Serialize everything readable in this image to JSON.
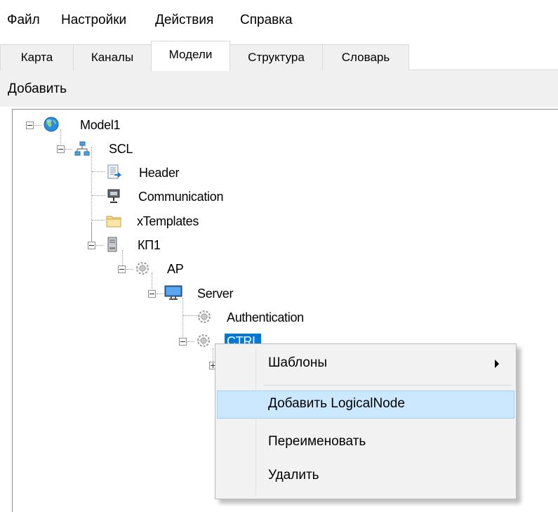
{
  "menubar": {
    "items": [
      "Файл",
      "Настройки",
      "Действия",
      "Справка"
    ]
  },
  "tabs": {
    "items": [
      "Карта",
      "Каналы",
      "Модели",
      "Структура",
      "Словарь"
    ],
    "active": "Модели"
  },
  "toolbar": {
    "add_label": "Добавить"
  },
  "tree": {
    "nodes": [
      {
        "label": "Model1",
        "icon": "globe-icon",
        "expanded": true
      },
      {
        "label": "SCL",
        "icon": "network-icon",
        "expanded": true
      },
      {
        "label": "Header",
        "icon": "document-icon"
      },
      {
        "label": "Communication",
        "icon": "network-card-icon"
      },
      {
        "label": "xTemplates",
        "icon": "folder-icon"
      },
      {
        "label": "КП1",
        "icon": "server-tower-icon",
        "expanded": true
      },
      {
        "label": "AP",
        "icon": "gear-node-icon",
        "expanded": true
      },
      {
        "label": "Server",
        "icon": "monitor-icon",
        "expanded": true
      },
      {
        "label": "Authentication",
        "icon": "gear-node-icon"
      },
      {
        "label": "CTRL",
        "icon": "gear-node-icon",
        "expanded": true,
        "selected": true
      },
      {
        "label": "",
        "icon": "",
        "expanded": false
      }
    ]
  },
  "context_menu": {
    "items": [
      {
        "label": "Шаблоны",
        "submenu": true
      },
      {
        "label": "Добавить LogicalNode",
        "highlighted": true
      },
      {
        "label": "Переименовать"
      },
      {
        "label": "Удалить"
      }
    ]
  },
  "colors": {
    "selection": "#0078d7",
    "menu_highlight": "#cce8ff",
    "toolbar_bg": "#f0f0f0"
  }
}
